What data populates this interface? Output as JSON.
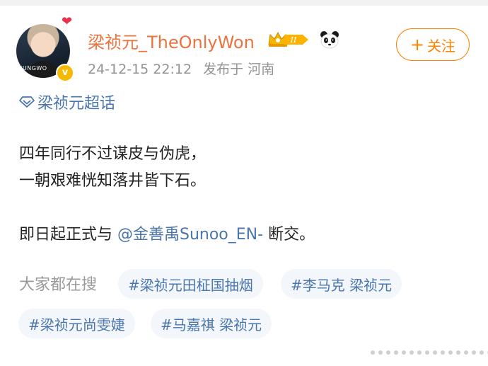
{
  "post": {
    "author": {
      "name": "梁祯元_TheOnlyWon",
      "avatar_caption": "JUNGWO",
      "verified_mark": "v"
    },
    "meta": {
      "time": "24-12-15 22:12",
      "location": "发布于 河南"
    },
    "follow_button": {
      "plus": "+",
      "label": "关注"
    },
    "topic": {
      "label": "梁祯元超话"
    },
    "body": {
      "line1": "四年同行不过谋皮与伪虎，",
      "line2": "一朝艰难恍知落井皆下石。",
      "line3_prefix": "即日起正式与 ",
      "mention": "@金善禹Sunoo_EN-",
      "line3_suffix": " 断交。"
    },
    "search": {
      "label": "大家都在搜",
      "tags": [
        "#梁祯元田柾国抽烟",
        "#李马克 梁祯元",
        "#梁祯元尚雯婕",
        "#马嘉祺 梁祯元"
      ]
    }
  },
  "colors": {
    "username": "#eb7340",
    "link": "#4a76ad",
    "follow": "#ff8200",
    "meta": "#939393",
    "tag_bg": "#f3f6fa"
  },
  "icons": [
    "heart-icon",
    "verified-icon",
    "crown-level-badge-icon",
    "panda-icon",
    "plus-icon",
    "diamond-topic-icon",
    "more-dots-icon"
  ]
}
